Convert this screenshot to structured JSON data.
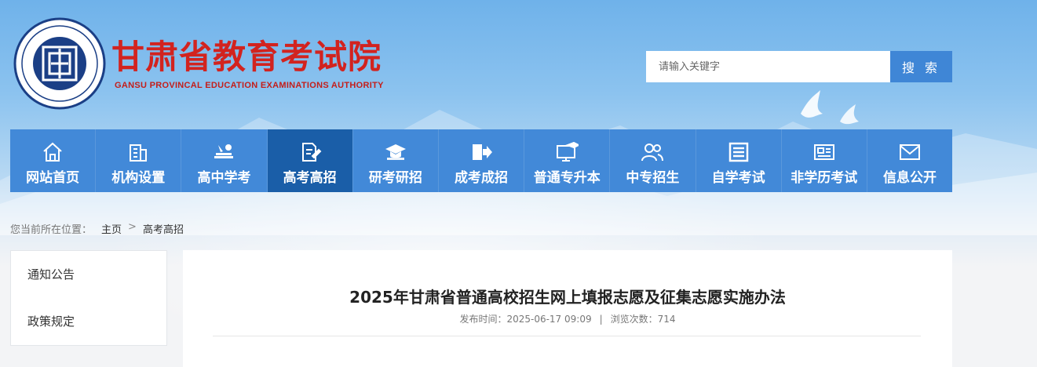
{
  "header": {
    "title": "甘肃省教育考试院",
    "subtitle": "GANSU PROVINCAL EDUCATION EXAMINATIONS AUTHORITY",
    "emblem_ring_text": "甘肃省教育考试院",
    "emblem_ring_text_en": "GANSU PROVINCAL EDUCATION EXAMINATIONS AUTHORITY",
    "brand_color": "#d2231f"
  },
  "search": {
    "placeholder": "请输入关键字",
    "button_label": "搜 索"
  },
  "nav": {
    "accent": "#4289d8",
    "active_color": "#1a5ea8",
    "items": [
      {
        "label": "网站首页",
        "icon": "home-icon"
      },
      {
        "label": "机构设置",
        "icon": "building-icon"
      },
      {
        "label": "高中学考",
        "icon": "books-icon"
      },
      {
        "label": "高考高招",
        "icon": "document-pen-icon",
        "active": true
      },
      {
        "label": "研考研招",
        "icon": "graduation-cap-icon"
      },
      {
        "label": "成考成招",
        "icon": "book-arrow-icon"
      },
      {
        "label": "普通专升本",
        "icon": "monitor-cap-icon"
      },
      {
        "label": "中专招生",
        "icon": "users-icon"
      },
      {
        "label": "自学考试",
        "icon": "list-doc-icon"
      },
      {
        "label": "非学历考试",
        "icon": "id-card-icon"
      },
      {
        "label": "信息公开",
        "icon": "mail-icon"
      }
    ]
  },
  "breadcrumb": {
    "prefix": "您当前所在位置：",
    "items": [
      "主页",
      "高考高招"
    ],
    "separator": ">"
  },
  "sidebar": {
    "items": [
      "通知公告",
      "政策规定"
    ]
  },
  "article": {
    "title": "2025年甘肃省普通高校招生网上填报志愿及征集志愿实施办法",
    "publish_label": "发布时间：",
    "publish_time": "2025-06-17 09:09",
    "separator": "|",
    "views_label": "浏览次数：",
    "views": "714"
  }
}
